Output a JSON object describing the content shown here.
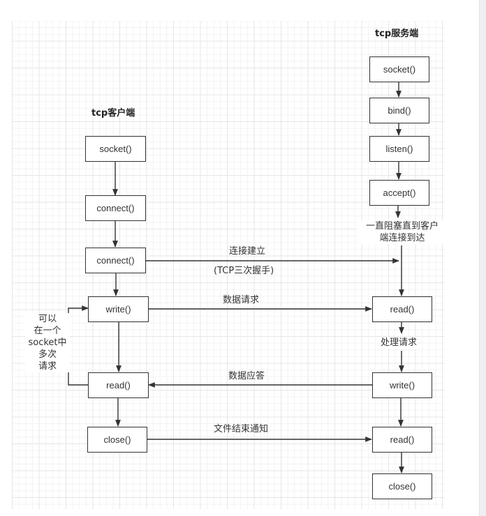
{
  "diagram": {
    "client": {
      "title": "tcp客户端",
      "steps": [
        "socket()",
        "connect()",
        "connect()",
        "write()",
        "read()",
        "close()"
      ],
      "loop_note": [
        "可以",
        "在一个",
        "socket中",
        "多次",
        "请求"
      ]
    },
    "server": {
      "title": "tcp服务端",
      "steps": [
        "socket()",
        "bind()",
        "listen()",
        "accept()",
        "read()",
        "write()",
        "read()",
        "close()"
      ],
      "block_note": [
        "一直阻塞直到客户",
        "端连接到达"
      ],
      "process_note": "处理请求"
    },
    "messages": {
      "connect_top": "连接建立",
      "connect_bottom": "(TCP三次握手)",
      "request": "数据请求",
      "response": "数据应答",
      "eof": "文件结束通知"
    }
  }
}
